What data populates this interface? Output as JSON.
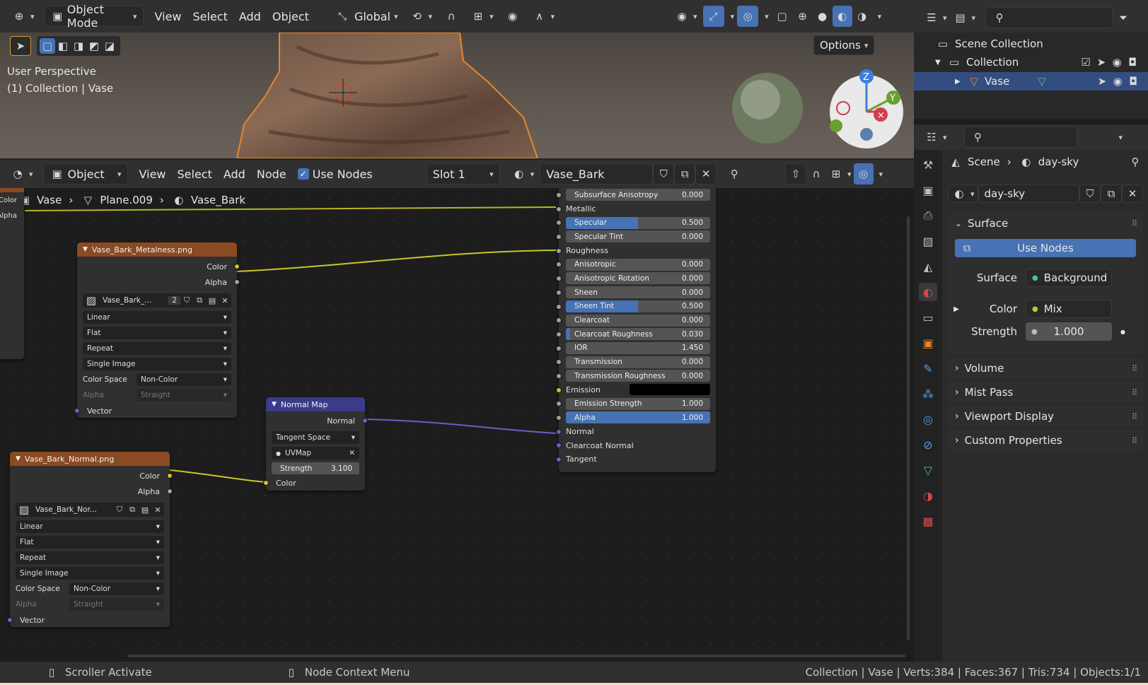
{
  "viewport_header": {
    "mode": "Object Mode",
    "menus": [
      "View",
      "Select",
      "Add",
      "Object"
    ],
    "transform_orientation": "Global",
    "options_label": "Options"
  },
  "viewport": {
    "perspective_label": "User Perspective",
    "collection_label": "(1) Collection | Vase",
    "gizmo_axes": [
      "Z",
      "Y"
    ]
  },
  "node_header": {
    "type": "Object",
    "menus": [
      "View",
      "Select",
      "Add",
      "Node"
    ],
    "use_nodes_label": "Use Nodes",
    "slot": "Slot 1",
    "material": "Vase_Bark"
  },
  "breadcrumb": [
    "Vase",
    "Plane.009",
    "Vase_Bark"
  ],
  "left_partial_node": {
    "labels": [
      "Color",
      "Alpha"
    ]
  },
  "metal_node": {
    "title": "Vase_Bark_Metalness.png",
    "outputs": [
      "Color",
      "Alpha"
    ],
    "image_name": "Vase_Bark_...",
    "users": "2",
    "interpolation": "Linear",
    "projection": "Flat",
    "extension": "Repeat",
    "source": "Single Image",
    "color_space_label": "Color Space",
    "color_space": "Non-Color",
    "alpha_label": "Alpha",
    "alpha_mode": "Straight",
    "input": "Vector"
  },
  "normal_tex_node": {
    "title": "Vase_Bark_Normal.png",
    "outputs": [
      "Color",
      "Alpha"
    ],
    "image_name": "Vase_Bark_Nor...",
    "interpolation": "Linear",
    "projection": "Flat",
    "extension": "Repeat",
    "source": "Single Image",
    "color_space_label": "Color Space",
    "color_space": "Non-Color",
    "alpha_label": "Alpha",
    "alpha_mode": "Straight",
    "input": "Vector"
  },
  "normal_map_node": {
    "title": "Normal Map",
    "output": "Normal",
    "space": "Tangent Space",
    "uv_map": "UVMap",
    "strength_label": "Strength",
    "strength": "3.100",
    "input": "Color"
  },
  "bsdf": {
    "rows": [
      {
        "label": "Subsurface Anisotropy",
        "value": "0.000",
        "kind": "slider",
        "fill": 0
      },
      {
        "label": "Metallic",
        "kind": "socket"
      },
      {
        "label": "Specular",
        "value": "0.500",
        "kind": "slider",
        "fill": 0.5
      },
      {
        "label": "Specular Tint",
        "value": "0.000",
        "kind": "slider",
        "fill": 0
      },
      {
        "label": "Roughness",
        "kind": "socket"
      },
      {
        "label": "Anisotropic",
        "value": "0.000",
        "kind": "slider",
        "fill": 0
      },
      {
        "label": "Anisotropic Rotation",
        "value": "0.000",
        "kind": "slider",
        "fill": 0
      },
      {
        "label": "Sheen",
        "value": "0.000",
        "kind": "slider",
        "fill": 0
      },
      {
        "label": "Sheen Tint",
        "value": "0.500",
        "kind": "slider",
        "fill": 0.5
      },
      {
        "label": "Clearcoat",
        "value": "0.000",
        "kind": "slider",
        "fill": 0
      },
      {
        "label": "Clearcoat Roughness",
        "value": "0.030",
        "kind": "slider",
        "fill": 0.03
      },
      {
        "label": "IOR",
        "value": "1.450",
        "kind": "slider",
        "fill": 0
      },
      {
        "label": "Transmission",
        "value": "0.000",
        "kind": "slider",
        "fill": 0
      },
      {
        "label": "Transmission Roughness",
        "value": "0.000",
        "kind": "slider",
        "fill": 0
      },
      {
        "label": "Emission",
        "kind": "color"
      },
      {
        "label": "Emission Strength",
        "value": "1.000",
        "kind": "slider",
        "fill": 0
      },
      {
        "label": "Alpha",
        "value": "1.000",
        "kind": "slider",
        "fill": 1
      },
      {
        "label": "Normal",
        "kind": "vsocket"
      },
      {
        "label": "Clearcoat Normal",
        "kind": "vsocket"
      },
      {
        "label": "Tangent",
        "kind": "vsocket"
      }
    ]
  },
  "outliner": {
    "scene_collection": "Scene Collection",
    "collection": "Collection",
    "object": "Vase"
  },
  "properties": {
    "breadcrumb_scene": "Scene",
    "breadcrumb_world": "day-sky",
    "world_name": "day-sky",
    "surface_panel": "Surface",
    "use_nodes": "Use Nodes",
    "surface_label": "Surface",
    "surface_value": "Background",
    "color_label": "Color",
    "color_value": "Mix",
    "strength_label": "Strength",
    "strength_value": "1.000",
    "panels": [
      "Volume",
      "Mist Pass",
      "Viewport Display",
      "Custom Properties"
    ]
  },
  "status_bar": {
    "left_hint": "Scroller Activate",
    "mid_hint": "Node Context Menu",
    "stats": "Collection | Vase | Verts:384 | Faces:367 | Tris:734 | Objects:1/1"
  },
  "colors": {
    "accent": "#4772b3",
    "image_node_header": "#8a4a22",
    "vector_node_header": "#3b3b8a",
    "socket_color": "#c7c729",
    "socket_vector": "#6363c7",
    "selection_outline": "#e8872a"
  }
}
